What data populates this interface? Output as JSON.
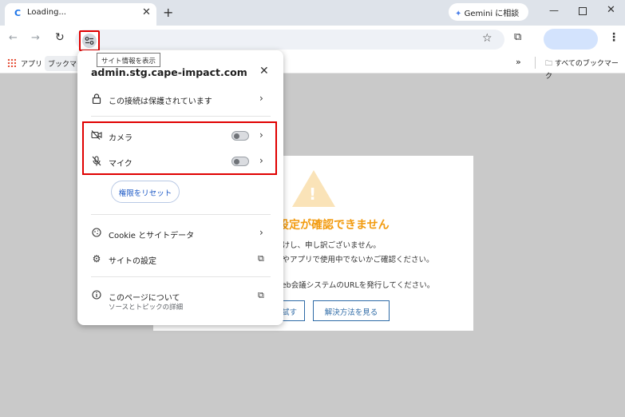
{
  "titlebar": {
    "tab_favicon": "C",
    "tab_title": "Loading...",
    "tab_close": "✕",
    "new_tab": "+",
    "gemini_label": "Gemini に相談",
    "win_min": "—",
    "win_close": "✕"
  },
  "toolbar": {
    "back": "←",
    "forward": "→",
    "reload": "↻",
    "bookmark_star": "☆",
    "extensions": "⧉",
    "menu": "⋮"
  },
  "tooltip": "サイト情報を表示",
  "bookmarks": {
    "apps": "アプリ",
    "bookmark_item": "ブックマー",
    "more": "»",
    "all_bookmarks": "すべてのブックマーク"
  },
  "dialog": {
    "warning_mark": "!",
    "title": "設定が確認できません",
    "line1": "かけし、申し訳ございません。",
    "line2": "ブやアプリで使用中でないかご確認ください。",
    "line3": "Web会議システムのURLを発行してください。",
    "retry_button": "試す",
    "solution_button": "解決方法を見る"
  },
  "popup": {
    "domain": "admin.stg.cape-impact.com",
    "close": "✕",
    "connection_label": "この接続は保護されています",
    "camera_label": "カメラ",
    "mic_label": "マイク",
    "reset_label": "権限をリセット",
    "cookie_label": "Cookie とサイトデータ",
    "site_settings_label": "サイトの設定",
    "about_label": "このページについて",
    "about_sub": "ソースとトピックの詳細",
    "chevron": "›",
    "external": "⧉"
  },
  "colors": {
    "accent_blue": "#1a73e8",
    "warning_orange": "#f29b0f",
    "highlight_red": "#e00000",
    "page_bg": "#c9c9c9"
  },
  "icons": [
    "lock-icon",
    "camera-off-icon",
    "mic-off-icon",
    "cookie-icon",
    "gear-icon",
    "info-icon",
    "external-link-icon",
    "tune-icon"
  ],
  "state": {
    "camera_enabled": false,
    "mic_enabled": false
  }
}
